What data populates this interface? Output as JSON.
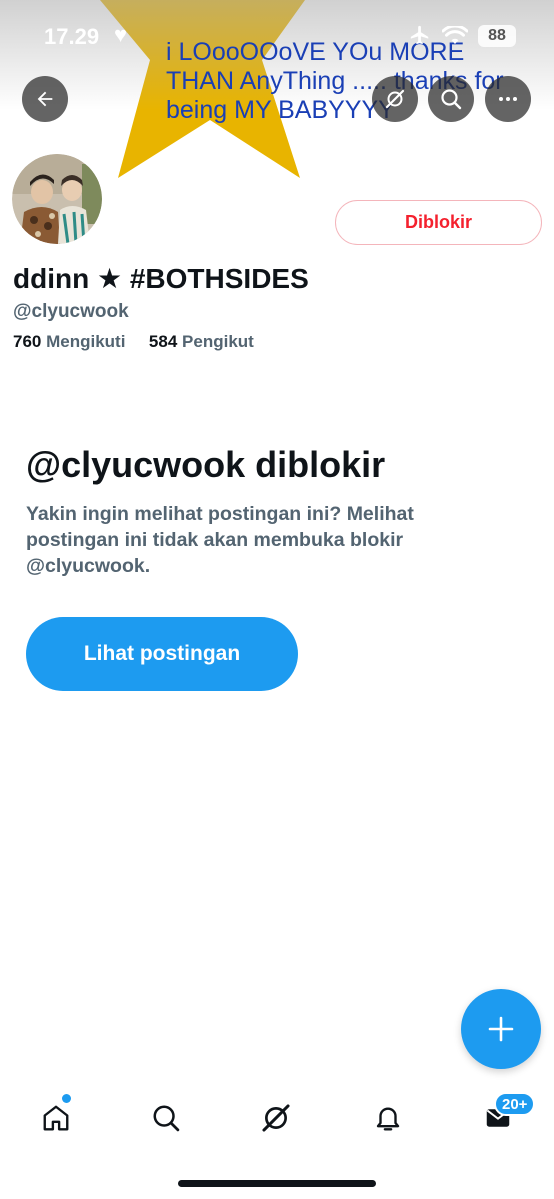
{
  "status_bar": {
    "time": "17.29",
    "battery": "88"
  },
  "banner": {
    "line1": "i LOooOOoVE YOu MORE",
    "line2": "THAN AnyThing ..... thanks for",
    "line3": "being MY BABYYYY",
    "star_color": "#e8b400",
    "text_color": "#1a3fb5"
  },
  "header": {
    "back_icon": "arrow-left-icon",
    "grok_icon": "grok-icon",
    "search_icon": "search-icon",
    "more_icon": "more-horizontal-icon"
  },
  "profile": {
    "display_name": "ddinn ★ #BOTHSIDES",
    "handle": "@clyucwook",
    "following_count": "760",
    "following_label": "Mengikuti",
    "followers_count": "584",
    "followers_label": "Pengikut",
    "blocked_button_label": "Diblokir"
  },
  "blocked_notice": {
    "title": "@clyucwook diblokir",
    "description": "Yakin ingin melihat postingan ini? Melihat postingan ini tidak akan membuka blokir @clyucwook.",
    "view_posts_label": "Lihat postingan"
  },
  "fab": {
    "icon": "plus-icon"
  },
  "bottom_nav": {
    "items": [
      {
        "name": "home",
        "icon": "home-icon"
      },
      {
        "name": "search",
        "icon": "search-icon"
      },
      {
        "name": "grok",
        "icon": "grok-icon"
      },
      {
        "name": "notifications",
        "icon": "bell-icon"
      },
      {
        "name": "messages",
        "icon": "mail-icon"
      }
    ],
    "messages_badge": "20+"
  },
  "colors": {
    "accent": "#1d9bf0",
    "danger": "#f4212e",
    "secondary_text": "#536471"
  }
}
